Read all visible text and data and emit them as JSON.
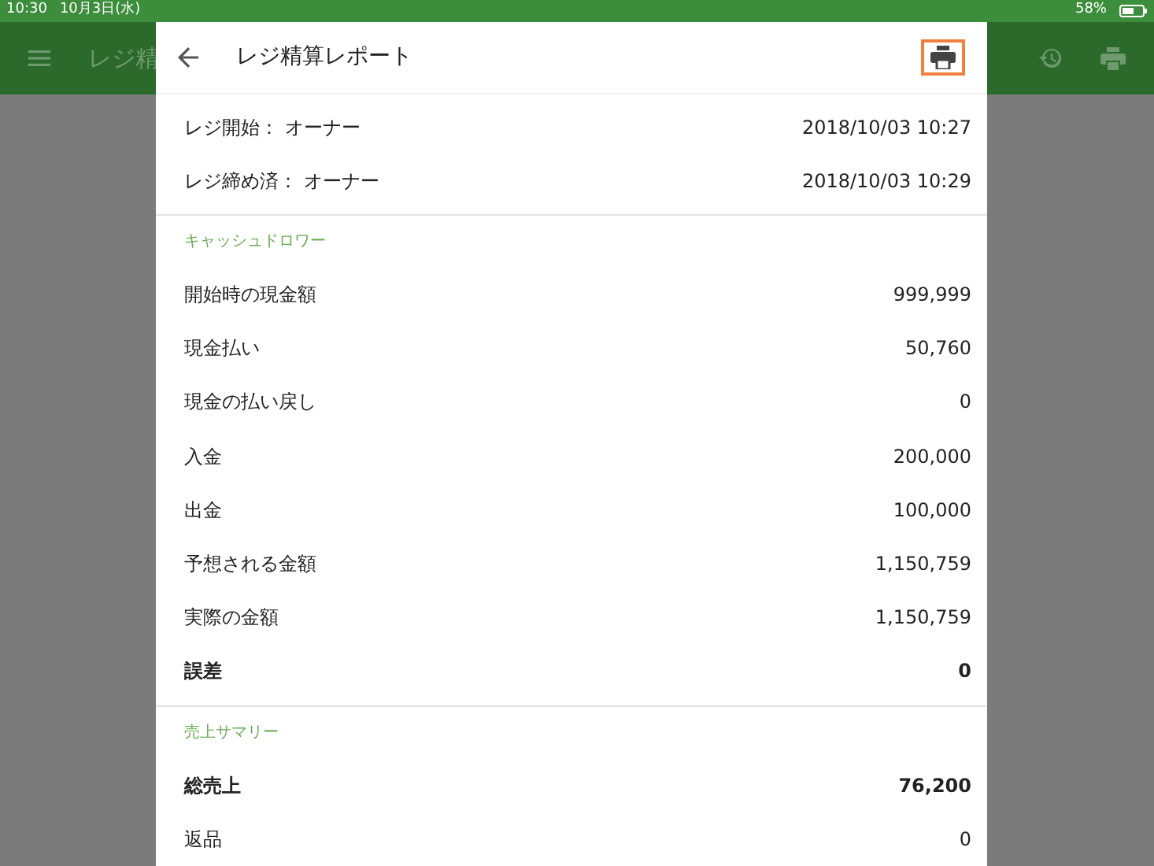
{
  "status_bar": {
    "time": "10:30",
    "date": "10月3日(水)",
    "battery": "58%"
  },
  "background_app": {
    "title": "レジ精"
  },
  "dialog": {
    "title": "レジ精算レポート",
    "print_highlighted": true,
    "info_rows": [
      {
        "label": "レジ開始： オーナー",
        "value": "2018/10/03 10:27"
      },
      {
        "label": "レジ締め済： オーナー",
        "value": "2018/10/03 10:29"
      }
    ],
    "sections": [
      {
        "heading": "キャッシュドロワー",
        "rows": [
          {
            "label": "開始時の現金額",
            "value": "999,999",
            "bold": false
          },
          {
            "label": "現金払い",
            "value": "50,760",
            "bold": false
          },
          {
            "label": "現金の払い戻し",
            "value": "0",
            "bold": false
          },
          {
            "label": "入金",
            "value": "200,000",
            "bold": false
          },
          {
            "label": "出金",
            "value": "100,000",
            "bold": false
          },
          {
            "label": "予想される金額",
            "value": "1,150,759",
            "bold": false
          },
          {
            "label": "実際の金額",
            "value": "1,150,759",
            "bold": false
          },
          {
            "label": "誤差",
            "value": "0",
            "bold": true
          }
        ]
      },
      {
        "heading": "売上サマリー",
        "rows": [
          {
            "label": "総売上",
            "value": "76,200",
            "bold": true
          },
          {
            "label": "返品",
            "value": "0",
            "bold": false
          }
        ]
      }
    ]
  }
}
